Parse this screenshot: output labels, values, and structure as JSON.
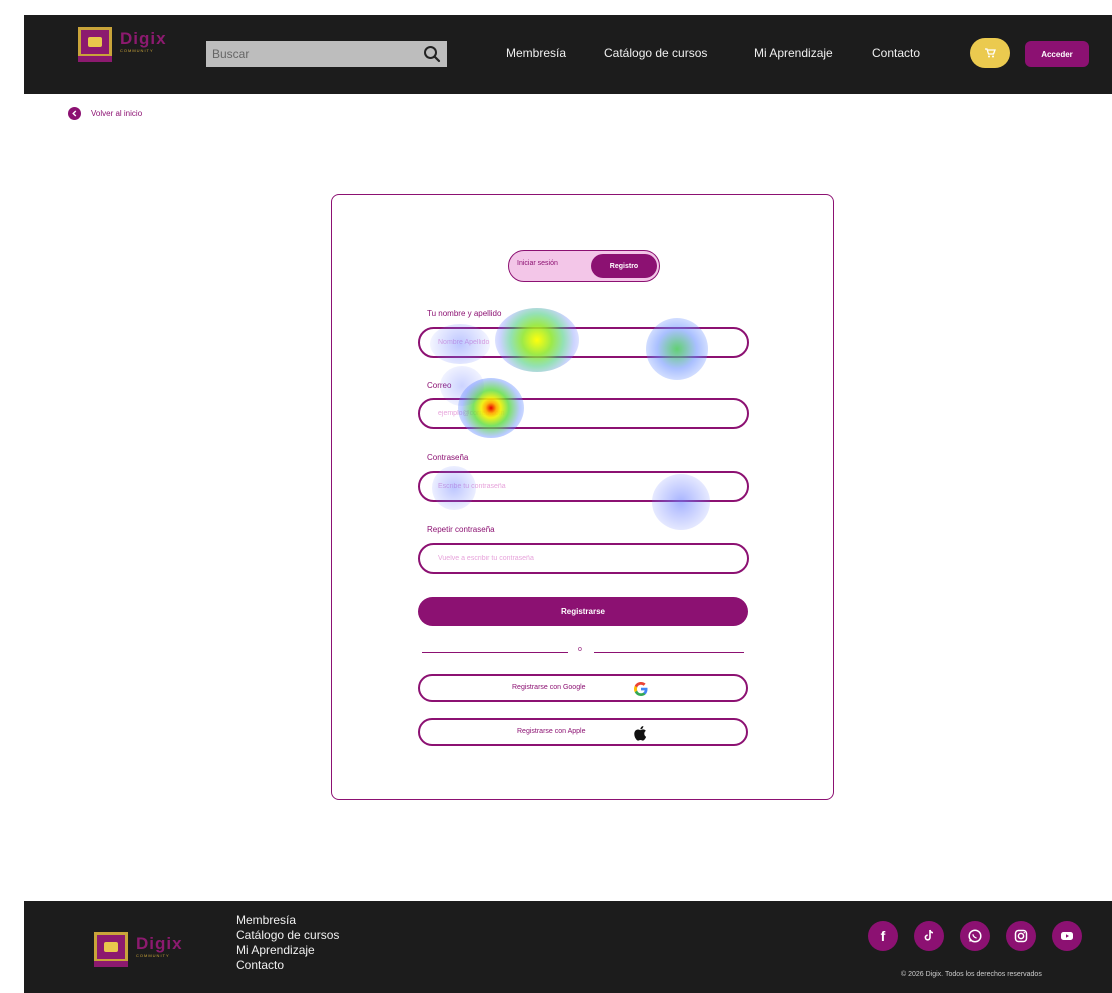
{
  "brand": {
    "name": "Digix",
    "tagline": "COMMUNITY",
    "logo_text": "Digix Community",
    "primary": "#8c1172",
    "accent": "#ebca4f"
  },
  "header": {
    "search_placeholder": "Buscar",
    "nav": [
      "Membresía",
      "Catálogo de cursos",
      "Mi Aprendizaje",
      "Contacto"
    ],
    "cart_icon": "cart-icon",
    "login_label": "Acceder"
  },
  "back_link": {
    "label": "Volver al inicio"
  },
  "form": {
    "tab_login": "Iniciar sesión",
    "tab_register": "Registro",
    "fields": [
      {
        "label": "Tu nombre y apellido",
        "placeholder": "Nombre Apellido"
      },
      {
        "label": "Correo",
        "placeholder": "ejemplo@correo.com"
      },
      {
        "label": "Contraseña",
        "placeholder": "Escribe tu contraseña"
      },
      {
        "label": "Repetir contraseña",
        "placeholder": "Vuelve a escribir tu contraseña"
      }
    ],
    "submit_label": "Registrarse",
    "divider_text": "o",
    "google_label": "Registrarse con Google",
    "apple_label": "Registrarse con Apple"
  },
  "footer": {
    "links": [
      "Membresía",
      "Catálogo de cursos",
      "Mi Aprendizaje",
      "Contacto"
    ],
    "social_icons": [
      "facebook-icon",
      "tiktok-icon",
      "whatsapp-icon",
      "instagram-icon",
      "youtube-icon"
    ],
    "copyright": "© 2026 Digix. Todos los derechos reservados"
  }
}
